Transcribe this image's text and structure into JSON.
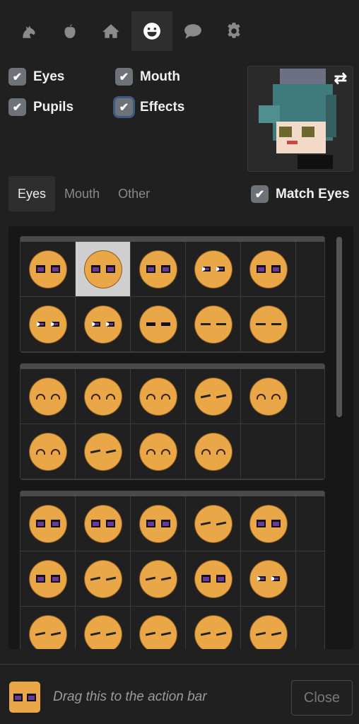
{
  "tabs": [
    {
      "icon": "horse-icon"
    },
    {
      "icon": "apple-icon"
    },
    {
      "icon": "home-icon"
    },
    {
      "icon": "smile-icon",
      "active": true
    },
    {
      "icon": "chat-icon"
    },
    {
      "icon": "gear-icon"
    }
  ],
  "options": {
    "eyes": "Eyes",
    "mouth": "Mouth",
    "pupils": "Pupils",
    "effects": "Effects",
    "match_eyes": "Match Eyes"
  },
  "preview": {
    "swap_icon": "⇄"
  },
  "subtabs": [
    "Eyes",
    "Mouth",
    "Other"
  ],
  "groups": [
    [
      "glass",
      "glass",
      "glass",
      "slit",
      "glass",
      "slit",
      "slit",
      "line",
      "dash",
      "dash"
    ],
    [
      "arc",
      "arc",
      "arc",
      "squint",
      "arc",
      "arc",
      "squint",
      "arc",
      "arc"
    ],
    [
      "glass",
      "glass",
      "glass",
      "squint",
      "glass",
      "glass",
      "squint",
      "squint",
      "glass",
      "slit",
      "squint",
      "squint",
      "squint",
      "squint",
      "squint"
    ]
  ],
  "selected": {
    "group": 0,
    "index": 1
  },
  "colors": {
    "face": "#e9a748",
    "pupil": "#6a3a9a",
    "accent": "#3d5a80"
  },
  "footer": {
    "hint": "Drag this to the action bar",
    "close": "Close"
  }
}
